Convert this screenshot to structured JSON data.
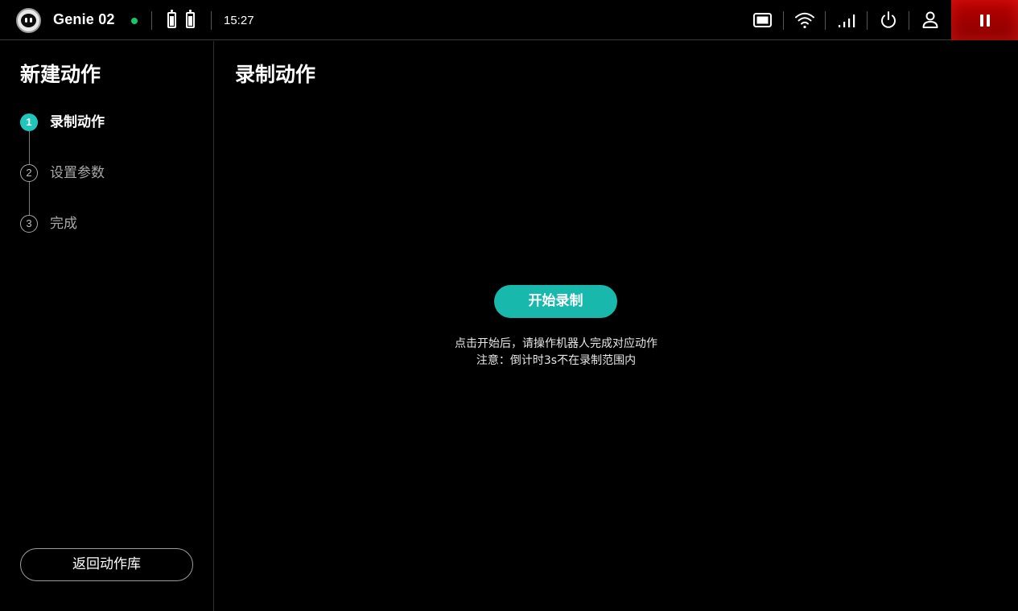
{
  "topbar": {
    "robot_name": "Genie 02",
    "time": "15:27",
    "icons": {
      "avatar": "robot-face-icon",
      "connection": "online-status-dot",
      "batteries": [
        "battery-icon",
        "battery-icon"
      ],
      "screen": "screen-icon",
      "wifi": "wifi-icon",
      "signal": "cellular-signal-icon",
      "power": "power-icon",
      "user": "user-icon",
      "pause": "pause-icon"
    },
    "colors": {
      "status_dot": "#19c46a",
      "pause_bg": "#b80000"
    }
  },
  "sidebar": {
    "title": "新建动作",
    "steps": [
      {
        "number": "1",
        "label": "录制动作",
        "active": true
      },
      {
        "number": "2",
        "label": "设置参数",
        "active": false
      },
      {
        "number": "3",
        "label": "完成",
        "active": false
      }
    ],
    "back_button": "返回动作库"
  },
  "main": {
    "title": "录制动作",
    "start_button": "开始录制",
    "hint_line1": "点击开始后，请操作机器人完成对应动作",
    "hint_line2": "注意：倒计时3s不在录制范围内"
  },
  "theme": {
    "accent": "#1fc6bb",
    "background": "#000000"
  }
}
